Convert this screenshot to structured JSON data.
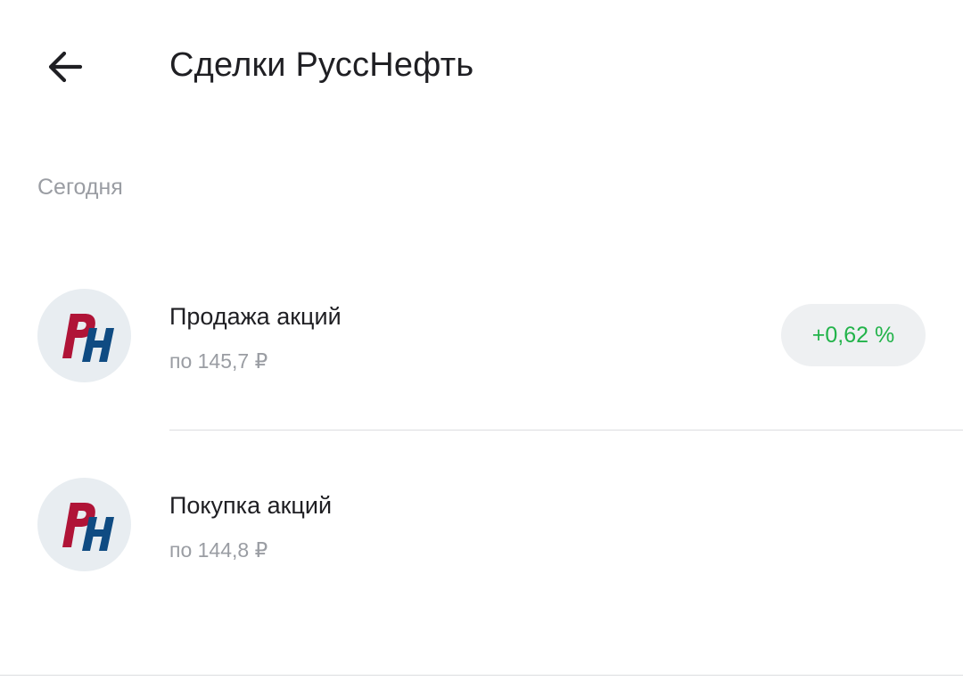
{
  "header": {
    "back_icon": "arrow-left-icon",
    "title": "Сделки РуссНефть"
  },
  "section": {
    "label": "Сегодня"
  },
  "deals": [
    {
      "logo": "russneft-logo",
      "title": "Продажа акций",
      "subtitle": "по 145,7 ₽",
      "change": "+0,62 %",
      "change_color": "#22b34a"
    },
    {
      "logo": "russneft-logo",
      "title": "Покупка акций",
      "subtitle": "по 144,8 ₽"
    }
  ],
  "colors": {
    "logo_red": "#b01437",
    "logo_blue": "#0f4b82",
    "avatar_bg": "#e8edf1",
    "badge_bg": "#eef0f2",
    "muted_text": "#9a9da3"
  }
}
